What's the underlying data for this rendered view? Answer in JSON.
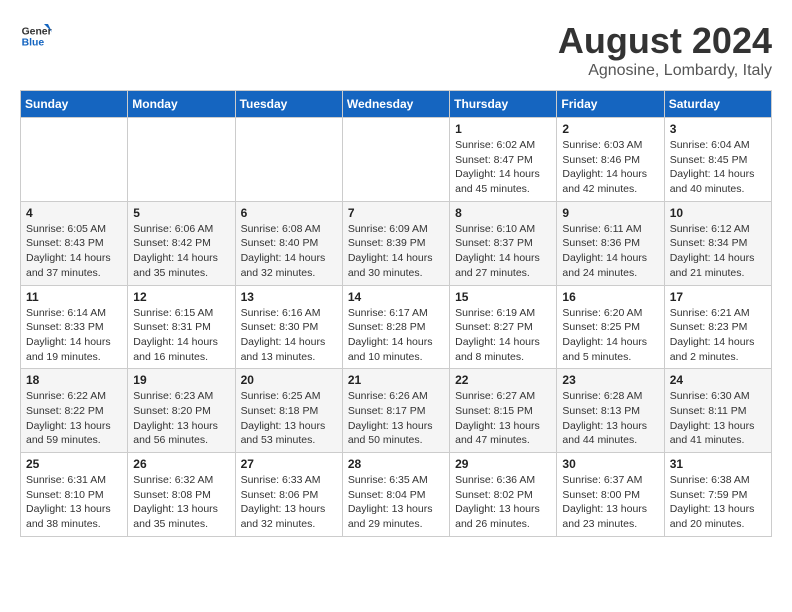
{
  "logo": {
    "general": "General",
    "blue": "Blue"
  },
  "header": {
    "month_year": "August 2024",
    "location": "Agnosine, Lombardy, Italy"
  },
  "days_of_week": [
    "Sunday",
    "Monday",
    "Tuesday",
    "Wednesday",
    "Thursday",
    "Friday",
    "Saturday"
  ],
  "weeks": [
    [
      {
        "day": "",
        "info": ""
      },
      {
        "day": "",
        "info": ""
      },
      {
        "day": "",
        "info": ""
      },
      {
        "day": "",
        "info": ""
      },
      {
        "day": "1",
        "info": "Sunrise: 6:02 AM\nSunset: 8:47 PM\nDaylight: 14 hours\nand 45 minutes."
      },
      {
        "day": "2",
        "info": "Sunrise: 6:03 AM\nSunset: 8:46 PM\nDaylight: 14 hours\nand 42 minutes."
      },
      {
        "day": "3",
        "info": "Sunrise: 6:04 AM\nSunset: 8:45 PM\nDaylight: 14 hours\nand 40 minutes."
      }
    ],
    [
      {
        "day": "4",
        "info": "Sunrise: 6:05 AM\nSunset: 8:43 PM\nDaylight: 14 hours\nand 37 minutes."
      },
      {
        "day": "5",
        "info": "Sunrise: 6:06 AM\nSunset: 8:42 PM\nDaylight: 14 hours\nand 35 minutes."
      },
      {
        "day": "6",
        "info": "Sunrise: 6:08 AM\nSunset: 8:40 PM\nDaylight: 14 hours\nand 32 minutes."
      },
      {
        "day": "7",
        "info": "Sunrise: 6:09 AM\nSunset: 8:39 PM\nDaylight: 14 hours\nand 30 minutes."
      },
      {
        "day": "8",
        "info": "Sunrise: 6:10 AM\nSunset: 8:37 PM\nDaylight: 14 hours\nand 27 minutes."
      },
      {
        "day": "9",
        "info": "Sunrise: 6:11 AM\nSunset: 8:36 PM\nDaylight: 14 hours\nand 24 minutes."
      },
      {
        "day": "10",
        "info": "Sunrise: 6:12 AM\nSunset: 8:34 PM\nDaylight: 14 hours\nand 21 minutes."
      }
    ],
    [
      {
        "day": "11",
        "info": "Sunrise: 6:14 AM\nSunset: 8:33 PM\nDaylight: 14 hours\nand 19 minutes."
      },
      {
        "day": "12",
        "info": "Sunrise: 6:15 AM\nSunset: 8:31 PM\nDaylight: 14 hours\nand 16 minutes."
      },
      {
        "day": "13",
        "info": "Sunrise: 6:16 AM\nSunset: 8:30 PM\nDaylight: 14 hours\nand 13 minutes."
      },
      {
        "day": "14",
        "info": "Sunrise: 6:17 AM\nSunset: 8:28 PM\nDaylight: 14 hours\nand 10 minutes."
      },
      {
        "day": "15",
        "info": "Sunrise: 6:19 AM\nSunset: 8:27 PM\nDaylight: 14 hours\nand 8 minutes."
      },
      {
        "day": "16",
        "info": "Sunrise: 6:20 AM\nSunset: 8:25 PM\nDaylight: 14 hours\nand 5 minutes."
      },
      {
        "day": "17",
        "info": "Sunrise: 6:21 AM\nSunset: 8:23 PM\nDaylight: 14 hours\nand 2 minutes."
      }
    ],
    [
      {
        "day": "18",
        "info": "Sunrise: 6:22 AM\nSunset: 8:22 PM\nDaylight: 13 hours\nand 59 minutes."
      },
      {
        "day": "19",
        "info": "Sunrise: 6:23 AM\nSunset: 8:20 PM\nDaylight: 13 hours\nand 56 minutes."
      },
      {
        "day": "20",
        "info": "Sunrise: 6:25 AM\nSunset: 8:18 PM\nDaylight: 13 hours\nand 53 minutes."
      },
      {
        "day": "21",
        "info": "Sunrise: 6:26 AM\nSunset: 8:17 PM\nDaylight: 13 hours\nand 50 minutes."
      },
      {
        "day": "22",
        "info": "Sunrise: 6:27 AM\nSunset: 8:15 PM\nDaylight: 13 hours\nand 47 minutes."
      },
      {
        "day": "23",
        "info": "Sunrise: 6:28 AM\nSunset: 8:13 PM\nDaylight: 13 hours\nand 44 minutes."
      },
      {
        "day": "24",
        "info": "Sunrise: 6:30 AM\nSunset: 8:11 PM\nDaylight: 13 hours\nand 41 minutes."
      }
    ],
    [
      {
        "day": "25",
        "info": "Sunrise: 6:31 AM\nSunset: 8:10 PM\nDaylight: 13 hours\nand 38 minutes."
      },
      {
        "day": "26",
        "info": "Sunrise: 6:32 AM\nSunset: 8:08 PM\nDaylight: 13 hours\nand 35 minutes."
      },
      {
        "day": "27",
        "info": "Sunrise: 6:33 AM\nSunset: 8:06 PM\nDaylight: 13 hours\nand 32 minutes."
      },
      {
        "day": "28",
        "info": "Sunrise: 6:35 AM\nSunset: 8:04 PM\nDaylight: 13 hours\nand 29 minutes."
      },
      {
        "day": "29",
        "info": "Sunrise: 6:36 AM\nSunset: 8:02 PM\nDaylight: 13 hours\nand 26 minutes."
      },
      {
        "day": "30",
        "info": "Sunrise: 6:37 AM\nSunset: 8:00 PM\nDaylight: 13 hours\nand 23 minutes."
      },
      {
        "day": "31",
        "info": "Sunrise: 6:38 AM\nSunset: 7:59 PM\nDaylight: 13 hours\nand 20 minutes."
      }
    ]
  ]
}
